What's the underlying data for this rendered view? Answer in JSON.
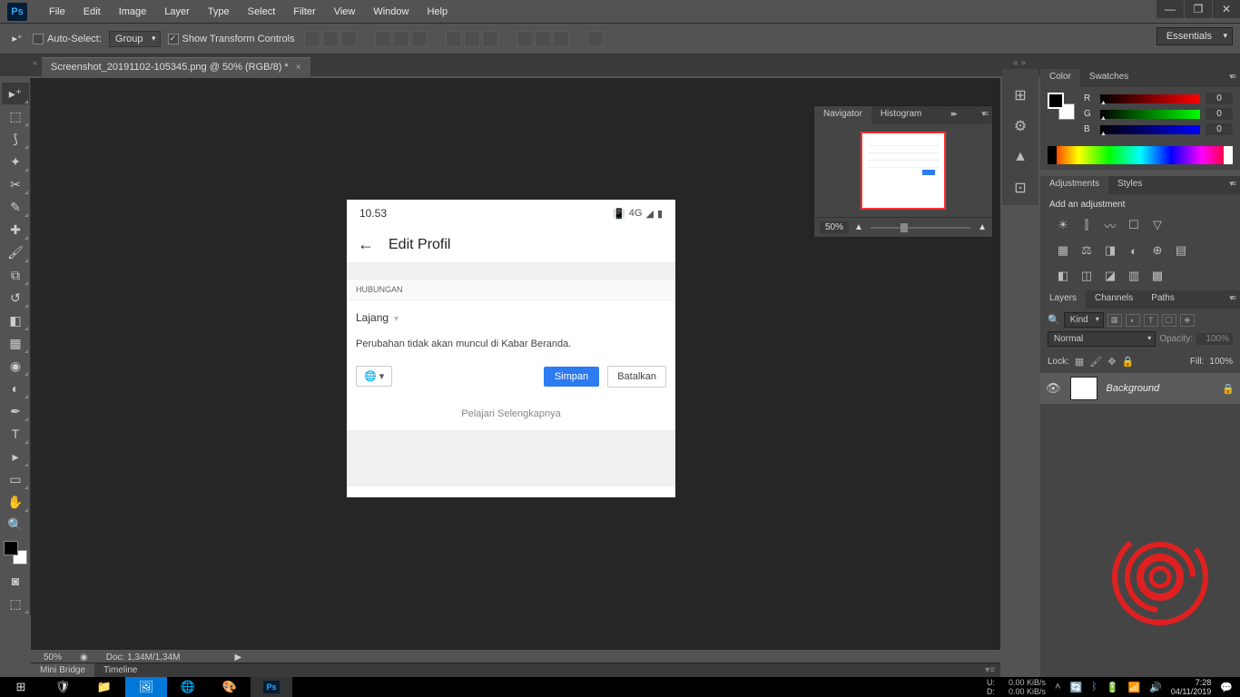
{
  "menubar": {
    "items": [
      "File",
      "Edit",
      "Image",
      "Layer",
      "Type",
      "Select",
      "Filter",
      "View",
      "Window",
      "Help"
    ]
  },
  "optionsbar": {
    "auto_select": "Auto-Select:",
    "group": "Group",
    "show_transform": "Show Transform Controls"
  },
  "workspace": "Essentials",
  "doc_tab": "Screenshot_20191102-105345.png @ 50% (RGB/8) *",
  "navigator": {
    "tabs": [
      "Navigator",
      "Histogram"
    ],
    "zoom": "50%"
  },
  "color_panel": {
    "tabs": [
      "Color",
      "Swatches"
    ],
    "r": "0",
    "g": "0",
    "b": "0"
  },
  "adjustments": {
    "tabs": [
      "Adjustments",
      "Styles"
    ],
    "label": "Add an adjustment"
  },
  "layers": {
    "tabs": [
      "Layers",
      "Channels",
      "Paths"
    ],
    "kind": "Kind",
    "blend": "Normal",
    "opacity_label": "Opacity:",
    "opacity": "100%",
    "lock_label": "Lock:",
    "fill_label": "Fill:",
    "fill": "100%",
    "layer_name": "Background"
  },
  "canvas_status": {
    "zoom": "50%",
    "doc": "Doc: 1,34M/1,34M"
  },
  "bottom_tabs": [
    "Mini Bridge",
    "Timeline"
  ],
  "phone": {
    "time": "10.53",
    "network": "4G",
    "title": "Edit Profil",
    "section": "HUBUNGAN",
    "status": "Lajang",
    "note": "Perubahan tidak akan muncul di Kabar Beranda.",
    "save": "Simpan",
    "cancel": "Batalkan",
    "learn": "Pelajari Selengkapnya"
  },
  "taskbar": {
    "net_u": "U:",
    "net_d": "D:",
    "net_speed": "0.00 KiB/s",
    "time": "7:28",
    "date": "04/11/2019"
  }
}
